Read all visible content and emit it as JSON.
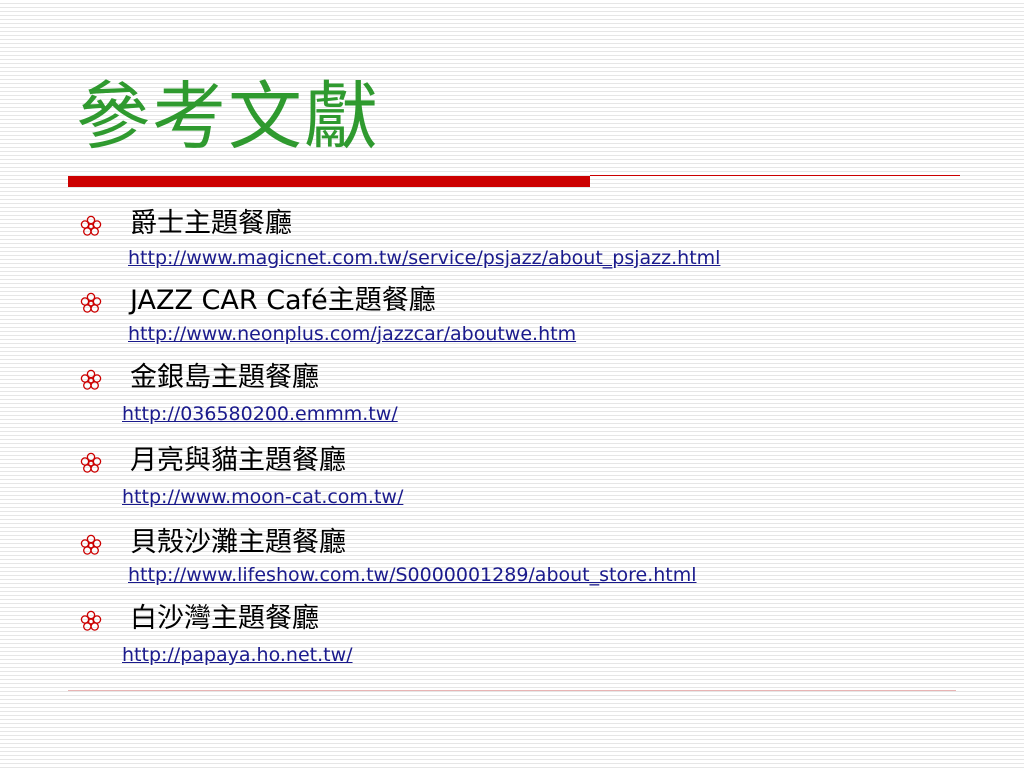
{
  "title": "參考文獻",
  "colors": {
    "title": "#2f9a2f",
    "accent_rule": "#cc0000",
    "link": "#1a1a8c",
    "bullet": "#cc0000"
  },
  "bullet_icon": "flower-icon",
  "items": [
    {
      "heading": "爵士主題餐廳",
      "url": "http://www.magicnet.com.tw/service/psjazz/about_psjazz.html"
    },
    {
      "heading": "JAZZ CAR Café主題餐廳",
      "url": "http://www.neonplus.com/jazzcar/aboutwe.htm"
    },
    {
      "heading": "金銀島主題餐廳",
      "url": "http://036580200.emmm.tw/"
    },
    {
      "heading": "月亮與貓主題餐廳",
      "url": "http://www.moon-cat.com.tw/"
    },
    {
      "heading": "貝殼沙灘主題餐廳",
      "url": "http://www.lifeshow.com.tw/S0000001289/about_store.html"
    },
    {
      "heading": "白沙灣主題餐廳",
      "url": "http://papaya.ho.net.tw/"
    }
  ]
}
